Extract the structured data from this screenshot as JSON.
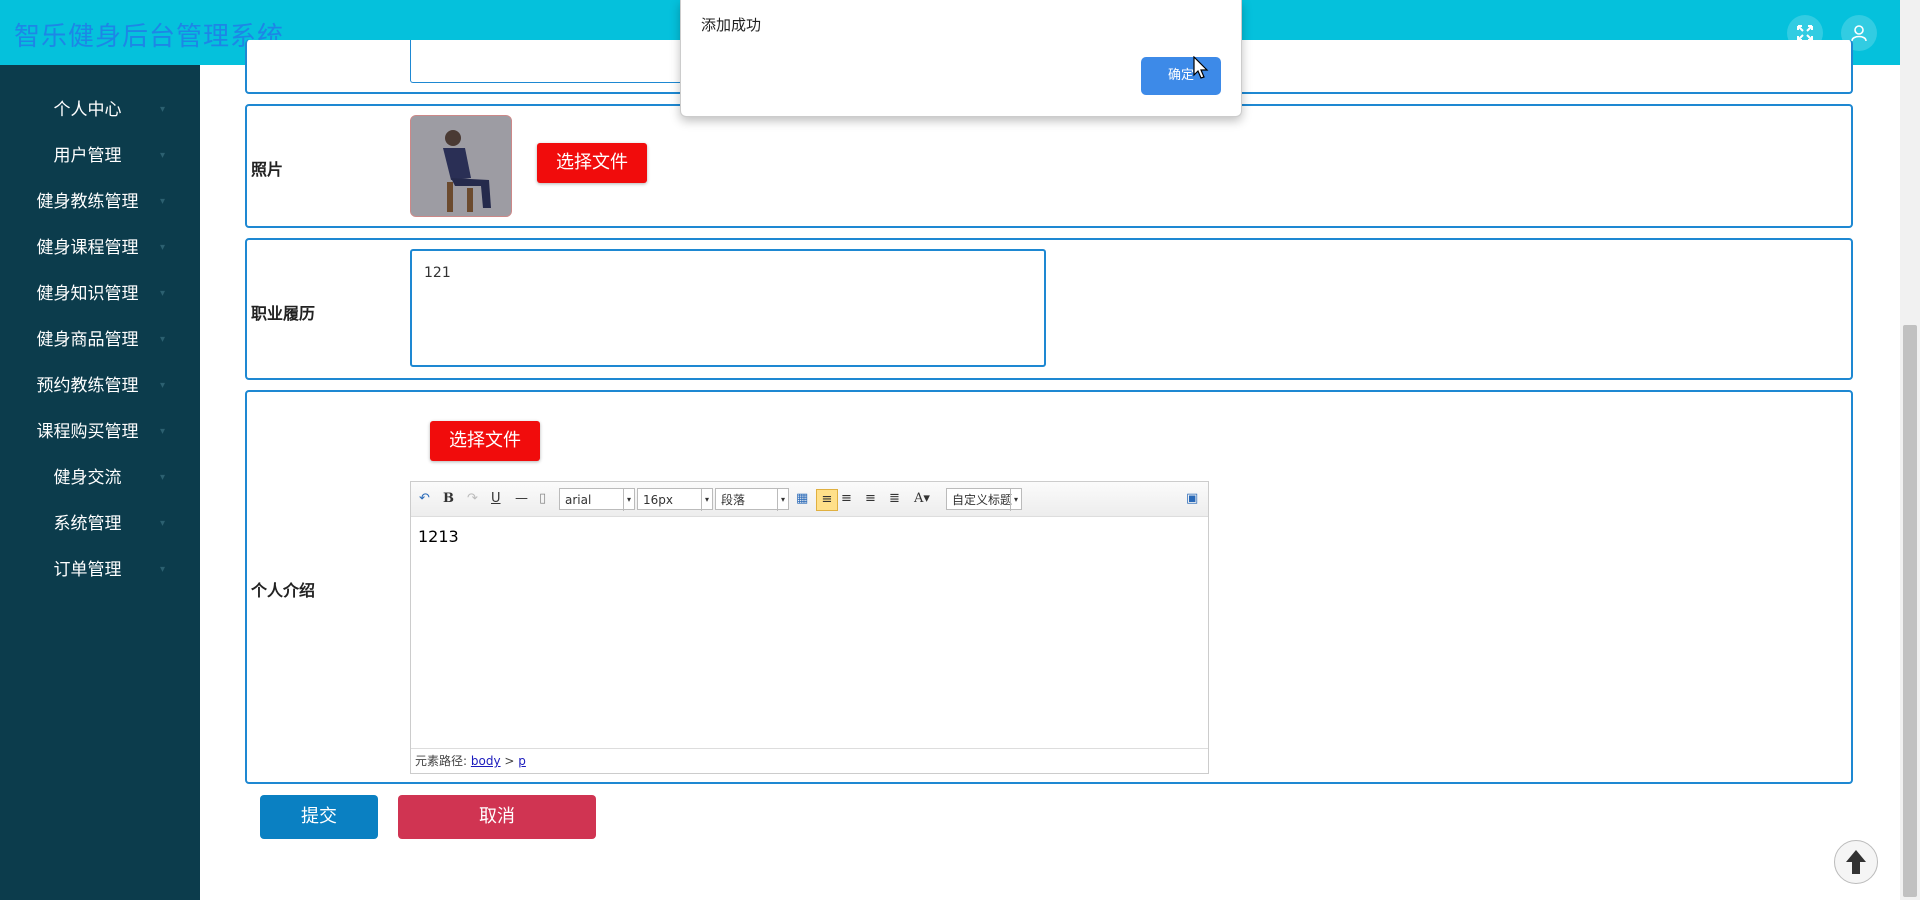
{
  "app": {
    "title": "智乐健身后台管理系统"
  },
  "header": {
    "fullscreen_icon": "fullscreen-icon",
    "user_icon": "user-icon"
  },
  "sidebar": {
    "items": [
      {
        "label": "个人中心"
      },
      {
        "label": "用户管理"
      },
      {
        "label": "健身教练管理"
      },
      {
        "label": "健身课程管理"
      },
      {
        "label": "健身知识管理"
      },
      {
        "label": "健身商品管理"
      },
      {
        "label": "预约教练管理"
      },
      {
        "label": "课程购买管理"
      },
      {
        "label": "健身交流"
      },
      {
        "label": "系统管理"
      },
      {
        "label": "订单管理"
      }
    ]
  },
  "form": {
    "photo": {
      "label": "照片",
      "upload_label": "选择文件"
    },
    "career": {
      "label": "职业履历",
      "value": "121"
    },
    "intro": {
      "label": "个人介绍",
      "upload_label": "选择文件",
      "editor": {
        "font_family": "arial",
        "font_size": "16px",
        "paragraph": "段落",
        "custom_title": "自定义标题",
        "content": "1213",
        "path_label": "元素路径:",
        "path_body": "body",
        "path_sep": ">",
        "path_p": "p"
      }
    },
    "submit_label": "提交",
    "cancel_label": "取消"
  },
  "dialog": {
    "message": "添加成功",
    "ok_label": "确定"
  },
  "colors": {
    "header": "#05c1dc",
    "sidebar": "#0c3c4c",
    "upload_button": "#f10c0c",
    "submit_button": "#0a80c2",
    "cancel_button": "#d03452",
    "row_border": "#1e88d2"
  }
}
